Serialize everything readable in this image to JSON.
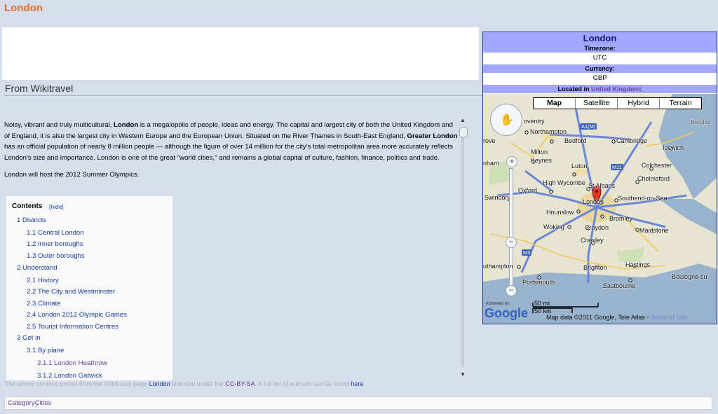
{
  "page": {
    "title": "London",
    "section_heading": "From Wikitravel"
  },
  "intro": {
    "p1_a": "Noisy, vibrant and truly multicultural, ",
    "p1_b": "London",
    "p1_c": " is a megalopolis of people, ideas and energy. The capital and largest city of both the United Kingdom and of England, it is also the largest city in Western Europe and the European Union. Situated on the River Thames in South-East England, ",
    "p1_d": "Greater London",
    "p1_e": " has an official population of nearly 8 million people — although the figure of over 14 million for the city's total metropolitan area more accurately reflects London's size and importance. London is one of the great \"world cities,\" and remains a global capital of culture, fashion, finance, politics and trade.",
    "p2": "London will host the 2012 Summer Olympics."
  },
  "toc": {
    "title": "Contents",
    "hide_label": "[hide]",
    "items": [
      {
        "label": "1 Districts"
      },
      {
        "label": "1.1 Central London"
      },
      {
        "label": "1.2 Inner boroughs"
      },
      {
        "label": "1.3 Outer boroughs"
      },
      {
        "label": "2 Understand"
      },
      {
        "label": "2.1 History"
      },
      {
        "label": "2.2 The City and Westminster"
      },
      {
        "label": "2.3 Climate"
      },
      {
        "label": "2.4 London 2012 Olympic Games"
      },
      {
        "label": "2.5 Tourist Information Centres"
      },
      {
        "label": "3 Get in"
      },
      {
        "label": "3.1 By plane"
      },
      {
        "label": "3.1.1 London Heathrow"
      },
      {
        "label": "3.1.2 London Gatwick"
      }
    ]
  },
  "infobox": {
    "title": "London",
    "timezone_label": "Timezone:",
    "timezone_value": "UTC",
    "currency_label": "Currency:",
    "currency_value": "GBP",
    "located_prefix": "Located in ",
    "located_link": "United Kingdom",
    "located_suffix": ":"
  },
  "map": {
    "types": [
      "Map",
      "Satellite",
      "Hybrid",
      "Terrain"
    ],
    "cities": [
      "oventry",
      "Northampton",
      "Bedford",
      "Cambridge",
      "Ipswich",
      "Milton Keynes",
      "Luton",
      "Colchester",
      "Chelmsford",
      "High Wycombe",
      "St Albans",
      "Oxford",
      "Swindon",
      "London",
      "Southend-on-Sea",
      "Hounslow",
      "Bromley",
      "Woking",
      "Croydon",
      "Maidstone",
      "Crawley",
      "Brighton",
      "Hastings",
      "Eastbourne",
      "Portsmouth",
      "uthampton",
      "Boulogne-su",
      "nham",
      "Beccles",
      "rove"
    ],
    "roads": [
      "A1(M)",
      "M11",
      "M3"
    ],
    "powered_by": "POWERED BY",
    "logo": "Google",
    "scale_mi": "50 mi",
    "scale_km": "50 km",
    "credit": "Map data ©2011 Google, Tele Atlas - ",
    "terms": "Terms of Use"
  },
  "footer": {
    "note_a": "The above content comes from the Wikitravel page ",
    "note_link": "London",
    "note_b": " licenced under the ",
    "note_license": "CC-BY-SA",
    "note_c": ". A full list of authors can be found ",
    "note_here": "here",
    "note_d": "."
  },
  "category": {
    "label": "Category",
    "sep": ": ",
    "value": "Cities"
  },
  "colors": {
    "title_orange": "#e0702a",
    "infobox_header": "#a2a8ff",
    "link_blue": "#1a3fa0"
  }
}
